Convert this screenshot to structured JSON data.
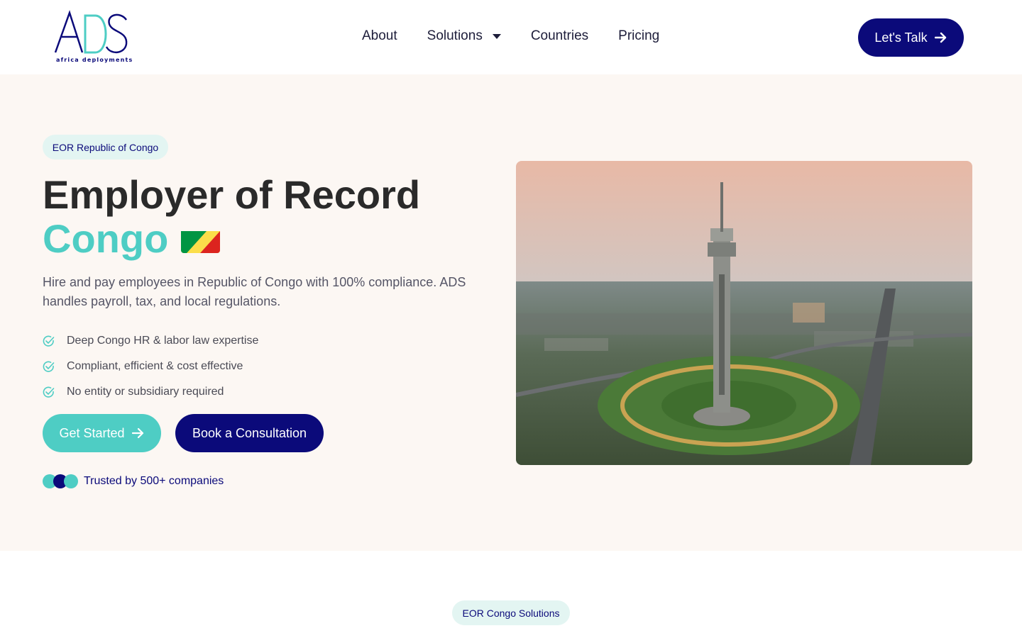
{
  "brand": {
    "logo_letters": "ADS",
    "tagline": "africa deployments",
    "navy": "#0b0a7a",
    "teal": "#4ecdc4"
  },
  "nav": {
    "about": "About",
    "solutions": "Solutions",
    "countries": "Countries",
    "pricing": "Pricing",
    "cta": "Let's Talk"
  },
  "hero": {
    "badge": "EOR Republic of Congo",
    "title_line1": "Employer of Record",
    "title_line2": "Congo",
    "intro": "Hire and pay employees in Republic of Congo with 100% compliance. ADS handles payroll, tax, and local regulations.",
    "checks": [
      "Deep Congo HR & labor law expertise",
      "Compliant, efficient & cost effective",
      "No entity or subsidiary required"
    ],
    "get_started": "Get Started",
    "book_consultation": "Book a Consultation",
    "trusted": "Trusted by 500+ companies"
  },
  "section2": {
    "badge": "EOR Congo Solutions"
  },
  "icons": {
    "check": "check-circle-icon",
    "arrow": "arrow-right-icon",
    "caret": "caret-down-icon",
    "flag": "congo-flag-icon"
  }
}
